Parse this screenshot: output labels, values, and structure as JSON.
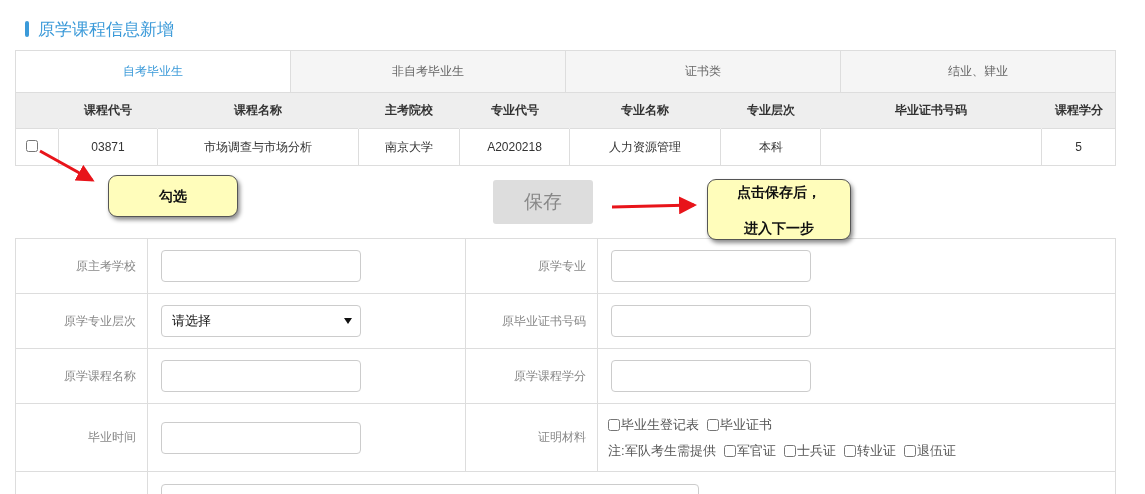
{
  "title": "原学课程信息新增",
  "tabs": [
    {
      "label": "自考毕业生",
      "selected": true
    },
    {
      "label": "非自考毕业生",
      "selected": false
    },
    {
      "label": "证书类",
      "selected": false
    },
    {
      "label": "结业、肄业",
      "selected": false
    }
  ],
  "table": {
    "columns": [
      "课程代号",
      "课程名称",
      "主考院校",
      "专业代号",
      "专业名称",
      "专业层次",
      "毕业证书号码",
      "课程学分"
    ],
    "rows": [
      {
        "checked": false,
        "cells": [
          "03871",
          "市场调查与市场分析",
          "南京大学",
          "A2020218",
          "人力资源管理",
          "本科",
          null,
          "5"
        ]
      }
    ]
  },
  "save_button": {
    "label": "保存",
    "disabled": true
  },
  "callouts": [
    {
      "lines": [
        "勾选"
      ]
    },
    {
      "lines": [
        "点击保存后，",
        "进入下一步"
      ]
    }
  ],
  "form": [
    {
      "kind": "input",
      "label": "原主考学校"
    },
    {
      "kind": "input",
      "label": "原学专业"
    },
    {
      "kind": "select",
      "label": "原学专业层次",
      "value": "请选择"
    },
    {
      "kind": "input",
      "label": "原毕业证书号码"
    },
    {
      "kind": "input",
      "label": "原学课程名称"
    },
    {
      "kind": "input",
      "label": "原学课程学分"
    },
    {
      "kind": "input",
      "label": "毕业时间"
    },
    {
      "kind": "checks",
      "label": "证明材料",
      "options": [
        {
          "label": "毕业生登记表",
          "checked": false
        },
        {
          "label": "毕业证书",
          "checked": false
        }
      ],
      "note": "注:军队考生需提供",
      "note_options": [
        {
          "label": "军官证",
          "checked": false
        },
        {
          "label": "士兵证",
          "checked": false
        },
        {
          "label": "转业证",
          "checked": false
        },
        {
          "label": "退伍证",
          "checked": false
        }
      ]
    },
    {
      "kind": "wide_input"
    }
  ]
}
